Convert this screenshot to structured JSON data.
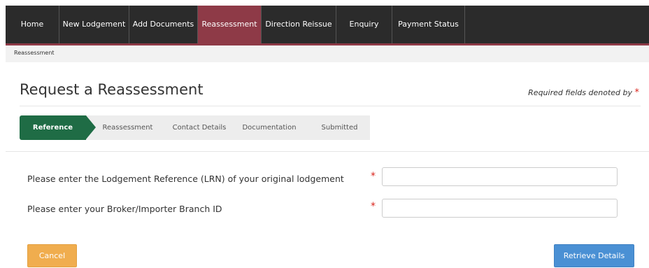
{
  "nav": {
    "items": [
      {
        "label": "Home"
      },
      {
        "label": "New Lodgement"
      },
      {
        "label": "Add Documents"
      },
      {
        "label": "Reassessment",
        "active": true
      },
      {
        "label": "Direction Reissue"
      },
      {
        "label": "Enquiry"
      },
      {
        "label": "Payment Status"
      }
    ]
  },
  "breadcrumb": "Reassessment",
  "page": {
    "title": "Request a Reassessment",
    "required_note": "Required fields denoted by",
    "required_star": "*"
  },
  "steps": [
    {
      "label": "Reference",
      "active": true
    },
    {
      "label": "Reassessment"
    },
    {
      "label": "Contact Details"
    },
    {
      "label": "Documentation"
    },
    {
      "label": "Submitted"
    }
  ],
  "form": {
    "lrn": {
      "label": "Please enter the Lodgement Reference (LRN) of your original lodgement",
      "star": "*",
      "value": ""
    },
    "branch": {
      "label": "Please enter your Broker/Importer Branch ID",
      "star": "*",
      "value": ""
    }
  },
  "buttons": {
    "cancel": "Cancel",
    "retrieve": "Retrieve Details"
  },
  "colors": {
    "nav_bg": "#2b2b2b",
    "nav_active": "#8e3a47",
    "step_active": "#1f6c45",
    "cancel": "#f0ad4e",
    "retrieve": "#4a90d4",
    "required": "#d9241c"
  }
}
